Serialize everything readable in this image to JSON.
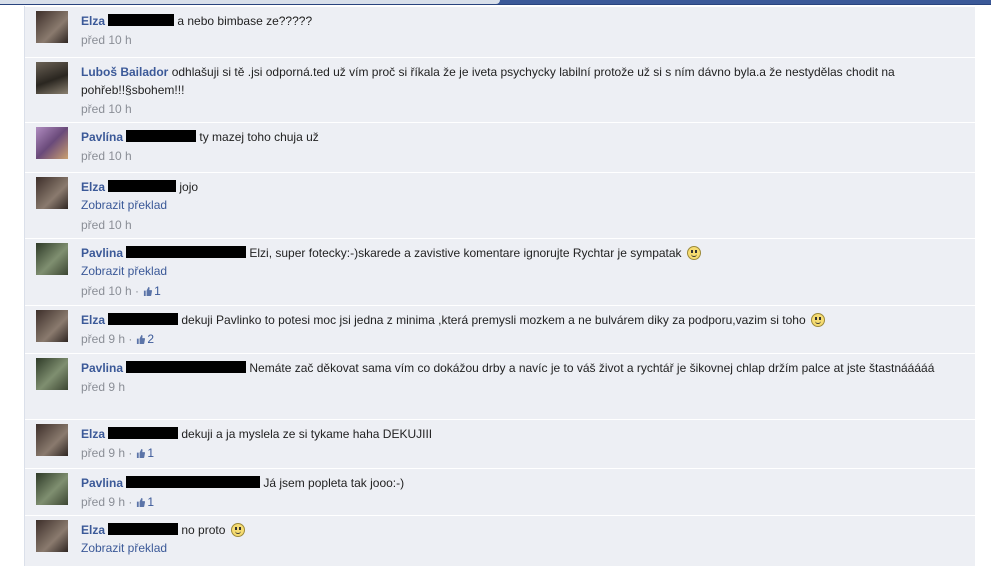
{
  "comments": [
    {
      "author": "Elza",
      "text": "a nebo bimbase ze?????",
      "translate": "",
      "time": "před 10 h",
      "likes": "",
      "smiley": false
    },
    {
      "author": "Luboš Bailador",
      "text": "odhlašuji si tě .jsi odporná.ted už vím proč si říkala že je iveta psychycky labilní protože už si s ním dávno byla.a že nestydělas chodit na pohřeb!!§sbohem!!!",
      "translate": "",
      "time": "před 10 h",
      "likes": "",
      "smiley": false
    },
    {
      "author": "Pavlína",
      "text": "ty mazej toho chuja už",
      "translate": "",
      "time": "před 10 h",
      "likes": "",
      "smiley": false
    },
    {
      "author": "Elza",
      "text": "jojo",
      "translate": "Zobrazit překlad",
      "time": "před 10 h",
      "likes": "",
      "smiley": false
    },
    {
      "author": "Pavlina",
      "text": "Elzi, super fotecky:-)skarede a zavistive komentare ignorujte Rychtar je sympatak",
      "translate": "Zobrazit překlad",
      "time": "před 10 h",
      "likes": "1",
      "smiley": true
    },
    {
      "author": "Elza",
      "text": "dekuji Pavlinko to potesi moc jsi jedna z minima ,která premysli mozkem a ne bulvárem diky za podporu,vazim si toho",
      "translate": "",
      "time": "před 9 h",
      "likes": "2",
      "smiley": true
    },
    {
      "author": "Pavlina",
      "text": "Nemáte zač děkovat sama vím co dokážou drby a navíc je to váš život a rychtář je šikovnej chlap držím palce at jste štastnááááá",
      "translate": "",
      "time": "před 9 h",
      "likes": "",
      "smiley": false
    },
    {
      "author": "Elza",
      "text": "dekuji a ja myslela ze si tykame haha DEKUJIII",
      "translate": "",
      "time": "před 9 h",
      "likes": "1",
      "smiley": false
    },
    {
      "author": "Pavlina",
      "text": "Já jsem popleta tak jooo:-)",
      "translate": "",
      "time": "před 9 h",
      "likes": "1",
      "smiley": false
    },
    {
      "author": "Elza",
      "text": "no proto",
      "translate": "Zobrazit překlad",
      "time": "",
      "likes": "",
      "smiley": true
    }
  ]
}
